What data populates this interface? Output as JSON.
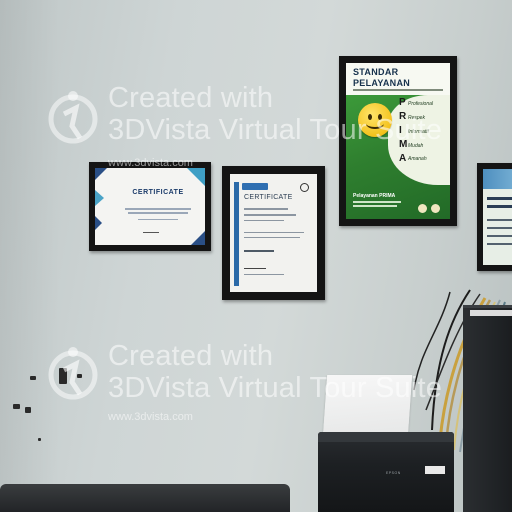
{
  "scene": {
    "description_colors": {
      "wall": "#ced5d5",
      "frame": "#141414",
      "poster_green": "#2f7f2f"
    }
  },
  "certificate_1": {
    "title": "CERTIFICATE"
  },
  "certificate_2": {
    "title": "CERTIFICATE"
  },
  "poster": {
    "title_line1": "STANDAR",
    "title_line2": "PELAYANAN",
    "prima_letters": [
      "P",
      "R",
      "I",
      "M",
      "A"
    ],
    "items": [
      "Profesional",
      "Respek",
      "Informatif",
      "Mudah",
      "Amanah"
    ],
    "footer_title": "Pelayanan PRIMA"
  },
  "printer": {
    "brand": "EPSON"
  },
  "watermark": {
    "line1": "Created with",
    "line2": "3DVista Virtual Tour Suite",
    "url": "www.3dvista.com"
  }
}
